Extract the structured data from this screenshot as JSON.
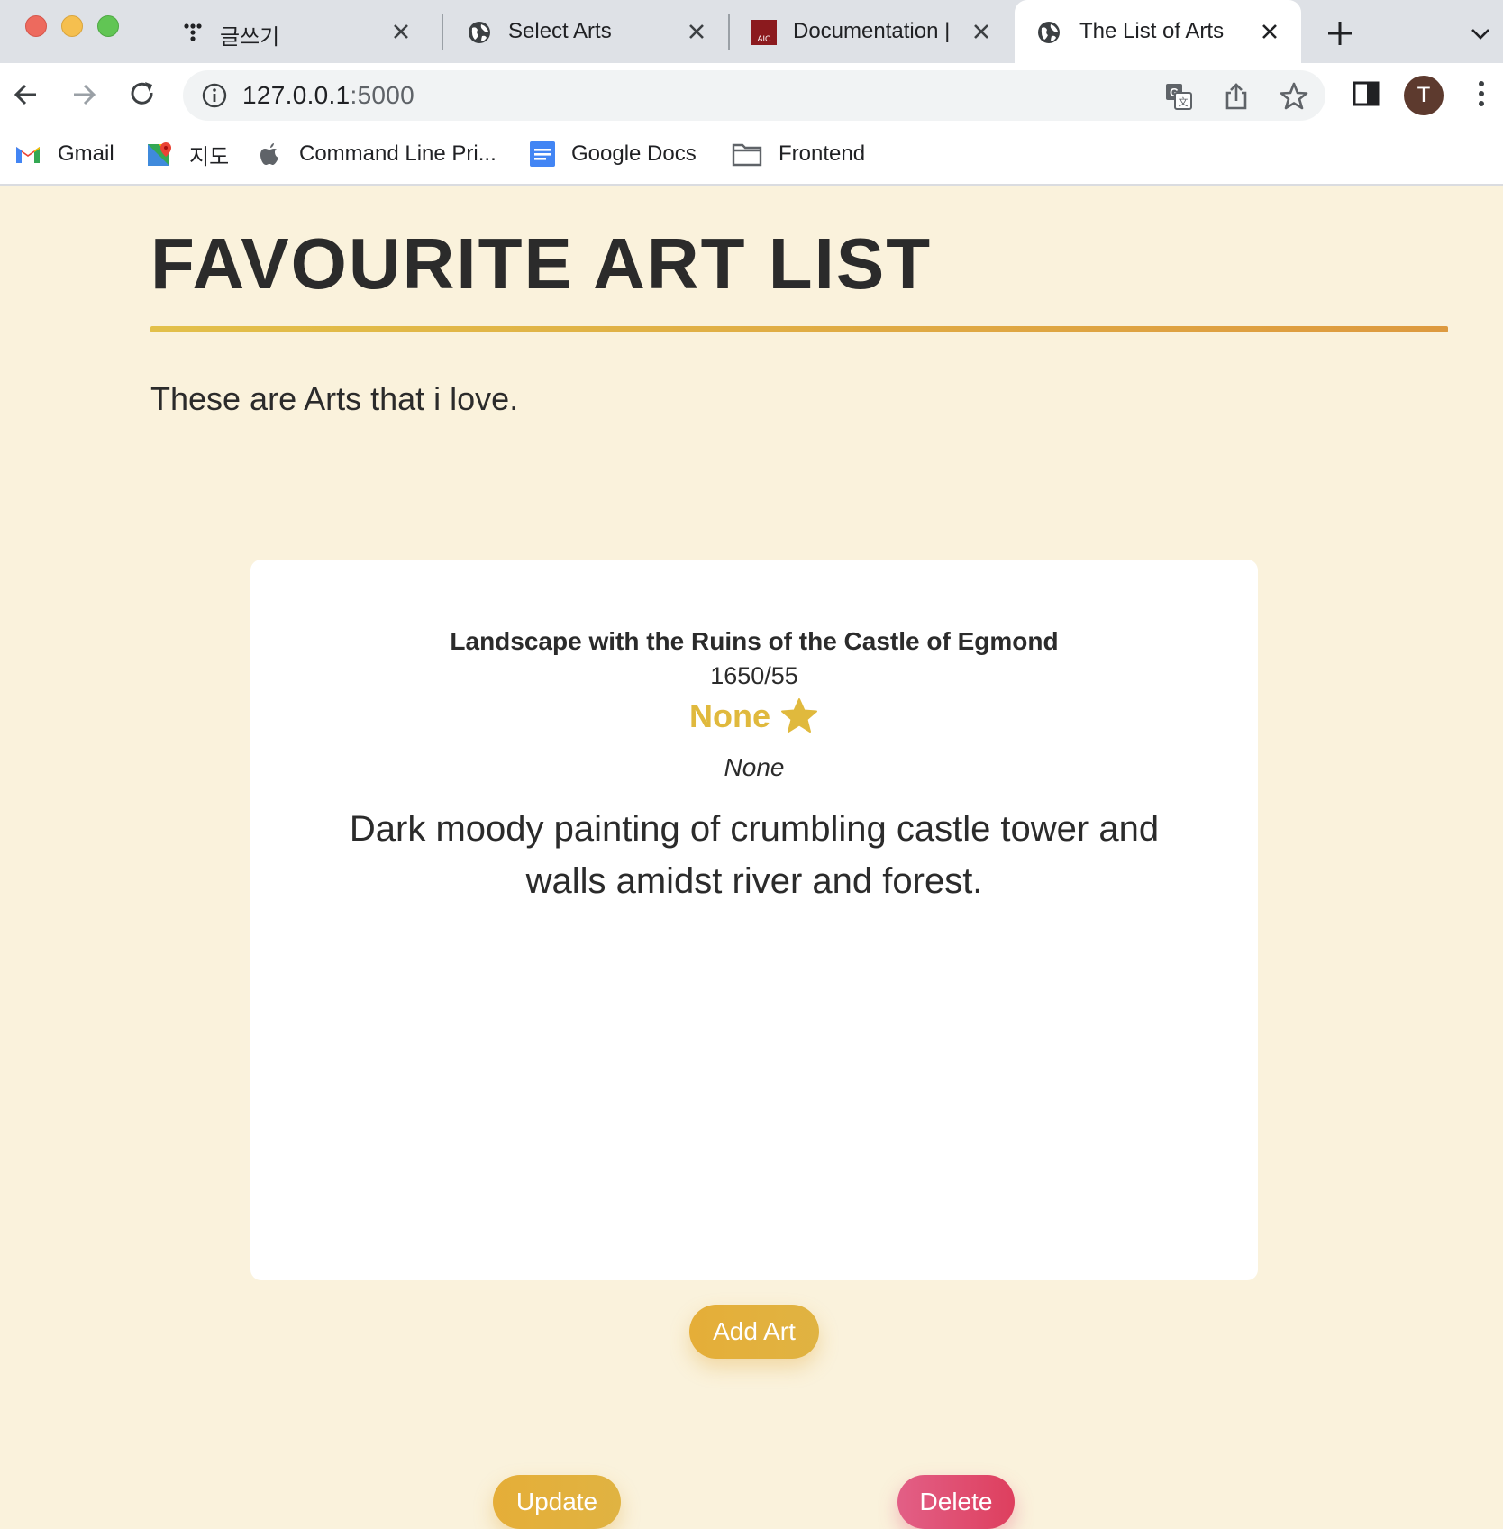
{
  "browser": {
    "tabs": [
      {
        "title": "글쓰기",
        "icon": "dots-app-icon",
        "active": false
      },
      {
        "title": "Select Arts",
        "icon": "globe-icon",
        "active": false
      },
      {
        "title": "Documentation |",
        "icon": "aic-logo-icon",
        "active": false
      },
      {
        "title": "The List of Arts",
        "icon": "globe-icon",
        "active": true
      }
    ],
    "url_host": "127.0.0.1",
    "url_port": ":5000",
    "profile_initial": "T",
    "bookmarks": [
      {
        "label": "Gmail",
        "icon": "gmail-icon"
      },
      {
        "label": "지도",
        "icon": "maps-icon"
      },
      {
        "label": "Command Line Pri...",
        "icon": "apple-icon"
      },
      {
        "label": "Google Docs",
        "icon": "docs-icon"
      },
      {
        "label": "Frontend",
        "icon": "folder-icon"
      }
    ]
  },
  "page": {
    "title": "FAVOURITE ART LIST",
    "subtitle": "These are Arts that i love.",
    "art": {
      "title": "Landscape with the Ruins of the Castle of Egmond",
      "date": "1650/55",
      "rating": "None",
      "artist": "None",
      "description": "Dark moody painting of crumbling castle tower and walls amidst river and forest."
    },
    "update_label": "Update",
    "delete_label": "Delete",
    "add_label": "Add Art"
  },
  "colors": {
    "background": "#faf2dc",
    "accent_gold": "#e0b93d",
    "delete_pink": "#e04d70"
  }
}
